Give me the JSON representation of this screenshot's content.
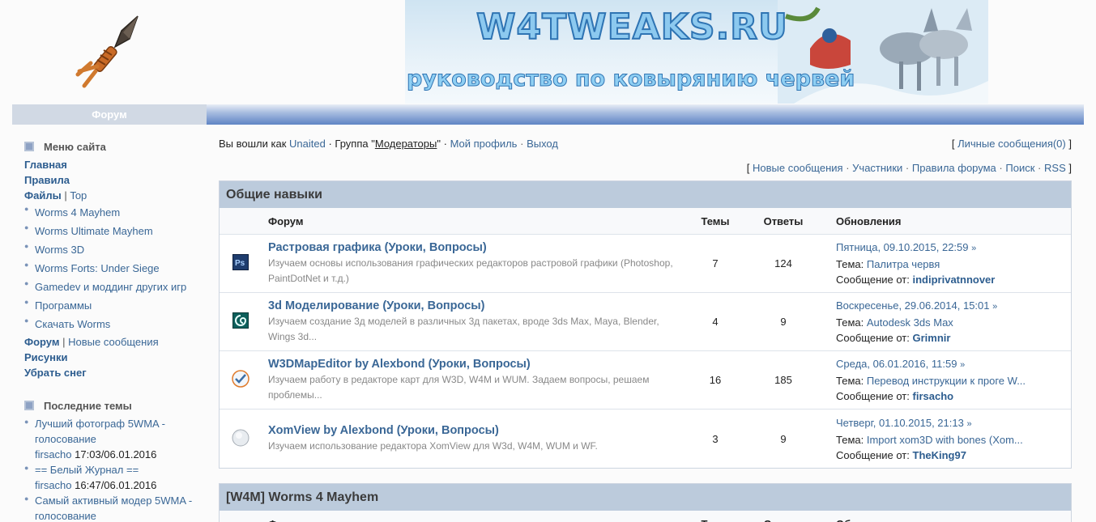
{
  "header": {
    "site_title": "W4TWEAKS.RU",
    "subtitle": "руководство по ковырянию червей",
    "nav_label": "Форум"
  },
  "sidebar": {
    "menu_title": "Меню сайта",
    "main": "Главная",
    "rules": "Правила",
    "files": "Файлы",
    "files_sep": "|",
    "top": "Top",
    "file_items": [
      "Worms 4 Mayhem",
      "Worms Ultimate Mayhem",
      "Worms 3D",
      "Worms Forts: Under Siege",
      "Gamedev и моддинг других игр",
      "Программы",
      "Скачать Worms"
    ],
    "forum": "Форум",
    "forum_sep": "|",
    "new_posts": "Новые сообщения",
    "pictures": "Рисунки",
    "remove_snow": "Убрать снег",
    "latest_title": "Последние темы",
    "latest": [
      {
        "title": "Лучший фотограф 5WMA - голосование",
        "user": "firsacho",
        "time": "17:03/06.01.2016"
      },
      {
        "title": "== Белый Журнал ==",
        "user": "firsacho",
        "time": "16:47/06.01.2016"
      },
      {
        "title": "Самый активный модер 5WMA - голосование",
        "user": "",
        "time": ""
      }
    ]
  },
  "userbar": {
    "logged_as": "Вы вошли как",
    "username": "Unaited",
    "group_prefix": "· Группа \"",
    "group": "Модераторы",
    "group_suffix": "\" ·",
    "profile": "Мой профиль",
    "dot": "·",
    "logout": "Выход",
    "pm_open": "[",
    "pm": "Личные сообщения(0)",
    "pm_close": "]",
    "links_open": "[",
    "new_msgs": "Новые сообщения",
    "members": "Участники",
    "forum_rules": "Правила форума",
    "search": "Поиск",
    "rss": "RSS",
    "links_close": "]"
  },
  "table_headers": {
    "forum": "Форум",
    "topics": "Темы",
    "replies": "Ответы",
    "updates": "Обновления"
  },
  "categories": [
    {
      "title": "Общие навыки",
      "forums": [
        {
          "icon": "photoshop-icon",
          "name": "Растровая графика (Уроки, Вопросы)",
          "desc": "Изучаем основы использования графических редакторов растровой графики (Photoshop, PaintDotNet и т.д.)",
          "topics": "7",
          "replies": "124",
          "date": "Пятница, 09.10.2015, 22:59",
          "topic_label": "Тема:",
          "topic": "Палитра червя",
          "from_label": "Сообщение от:",
          "author": "indiprivatnnover"
        },
        {
          "icon": "3dsmax-icon",
          "name": "3d Моделирование (Уроки, Вопросы)",
          "desc": "Изучаем создание 3д моделей в различных 3д пакетах, вроде 3ds Max, Maya, Blender, Wings 3d...",
          "topics": "4",
          "replies": "9",
          "date": "Воскресенье, 29.06.2014, 15:01",
          "topic_label": "Тема:",
          "topic": "Autodesk 3ds Max",
          "from_label": "Сообщение от:",
          "author": "Grimnir"
        },
        {
          "icon": "map-editor-icon",
          "name": "W3DMapEditor by Alexbond (Уроки, Вопросы)",
          "desc": "Изучаем работу в редакторе карт для W3D, W4M и WUM. Задаем вопросы, решаем проблемы...",
          "topics": "16",
          "replies": "185",
          "date": "Среда, 06.01.2016, 11:59",
          "topic_label": "Тема:",
          "topic": "Перевод инструкции к проге W...",
          "from_label": "Сообщение от:",
          "author": "firsacho"
        },
        {
          "icon": "xomview-icon",
          "name": "XomView by Alexbond (Уроки, Вопросы)",
          "desc": "Изучаем использование редактора XomView для W3d, W4M, WUM и WF.",
          "topics": "3",
          "replies": "9",
          "date": "Четверг, 01.10.2015, 21:13",
          "topic_label": "Тема:",
          "topic": "Import xom3D with bones (Xom...",
          "from_label": "Сообщение от:",
          "author": "TheKing97"
        }
      ]
    },
    {
      "title": "[W4M] Worms 4 Mayhem"
    }
  ],
  "colors": {
    "link": "#3a6796",
    "cat_header": "#bccbdc",
    "nav_bar": "#5f84c4"
  }
}
